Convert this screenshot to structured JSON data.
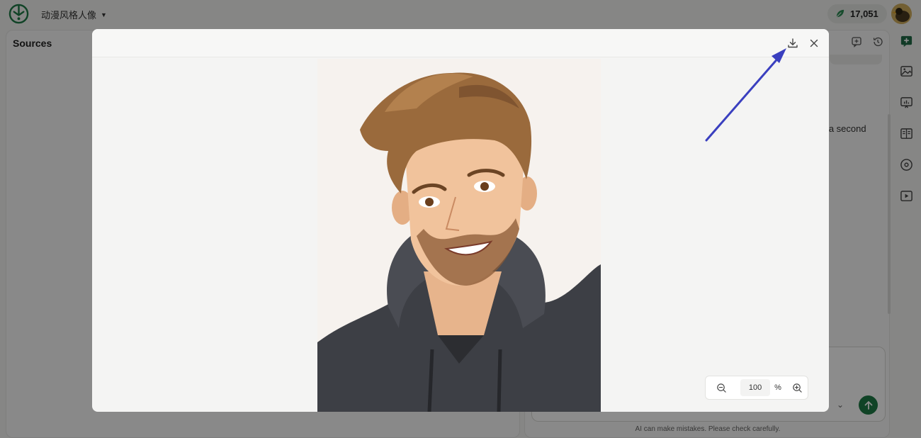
{
  "app": {
    "project_name": "动漫风格人像",
    "credits": "17,051"
  },
  "sources": {
    "title": "Sources"
  },
  "chat": {
    "visible_text": "e a second",
    "disclaimer": "AI can make mistakes. Please check carefully."
  },
  "modal": {
    "zoom": {
      "value": "100",
      "unit": "%"
    }
  },
  "icons": {
    "download": "download-icon",
    "close": "close-icon",
    "zoom_out": "zoom-out-icon",
    "zoom_in": "zoom-in-icon"
  },
  "colors": {
    "accent": "#1e7a46",
    "arrow": "#3a3fbf",
    "hoodie": "#3d3f45",
    "hair": "#9a6a3c"
  }
}
